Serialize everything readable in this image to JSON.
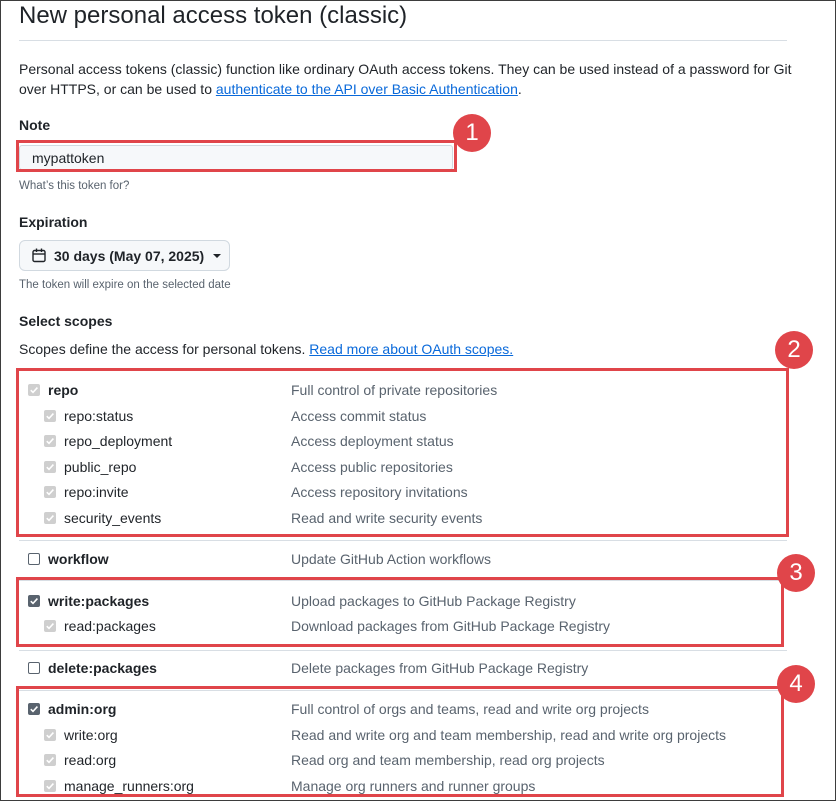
{
  "title": "New personal access token (classic)",
  "intro": {
    "text": "Personal access tokens (classic) function like ordinary OAuth access tokens. They can be used instead of a password for Git over HTTPS, or can be used to ",
    "link": "authenticate to the API over Basic Authentication",
    "end": "."
  },
  "note": {
    "label": "Note",
    "value": "mypattoken",
    "hint": "What’s this token for?"
  },
  "expiration": {
    "label": "Expiration",
    "value": "30 days (May 07, 2025)",
    "hint": "The token will expire on the selected date"
  },
  "scopes": {
    "label": "Select scopes",
    "desc": "Scopes define the access for personal tokens. ",
    "link": "Read more about OAuth scopes."
  },
  "callouts": [
    "1",
    "2",
    "3",
    "4"
  ],
  "rows": [
    {
      "name": "repo",
      "desc": "Full control of private repositories",
      "state": "disabled",
      "level": "top"
    },
    {
      "name": "repo:status",
      "desc": "Access commit status",
      "state": "disabled",
      "level": "sub"
    },
    {
      "name": "repo_deployment",
      "desc": "Access deployment status",
      "state": "disabled",
      "level": "sub"
    },
    {
      "name": "public_repo",
      "desc": "Access public repositories",
      "state": "disabled",
      "level": "sub"
    },
    {
      "name": "repo:invite",
      "desc": "Access repository invitations",
      "state": "disabled",
      "level": "sub"
    },
    {
      "name": "security_events",
      "desc": "Read and write security events",
      "state": "disabled",
      "level": "sub"
    },
    {
      "name": "workflow",
      "desc": "Update GitHub Action workflows",
      "state": "unchecked",
      "level": "top"
    },
    {
      "name": "write:packages",
      "desc": "Upload packages to GitHub Package Registry",
      "state": "checked",
      "level": "top"
    },
    {
      "name": "read:packages",
      "desc": "Download packages from GitHub Package Registry",
      "state": "disabled",
      "level": "sub"
    },
    {
      "name": "delete:packages",
      "desc": "Delete packages from GitHub Package Registry",
      "state": "unchecked",
      "level": "top"
    },
    {
      "name": "admin:org",
      "desc": "Full control of orgs and teams, read and write org projects",
      "state": "checked",
      "level": "top"
    },
    {
      "name": "write:org",
      "desc": "Read and write org and team membership, read and write org projects",
      "state": "disabled",
      "level": "sub"
    },
    {
      "name": "read:org",
      "desc": "Read org and team membership, read org projects",
      "state": "disabled",
      "level": "sub"
    },
    {
      "name": "manage_runners:org",
      "desc": "Manage org runners and runner groups",
      "state": "disabled",
      "level": "sub"
    }
  ],
  "colors": {
    "callout": "#e0454a",
    "link": "#0969da"
  }
}
